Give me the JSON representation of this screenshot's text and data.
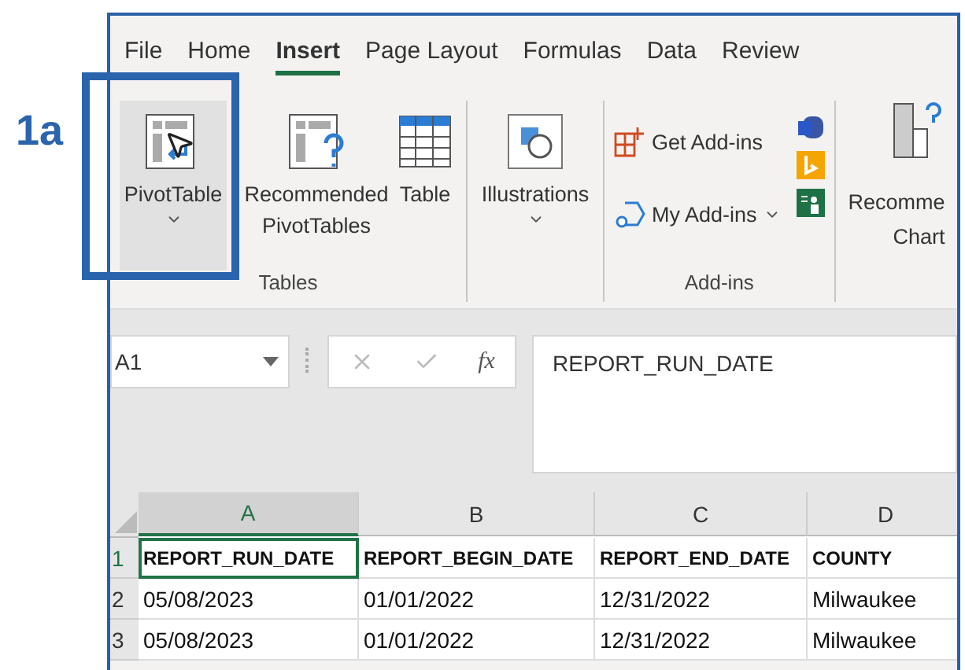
{
  "callout": {
    "label": "1a"
  },
  "tabs": [
    {
      "label": "File",
      "selected": false
    },
    {
      "label": "Home",
      "selected": false
    },
    {
      "label": "Insert",
      "selected": true
    },
    {
      "label": "Page Layout",
      "selected": false
    },
    {
      "label": "Formulas",
      "selected": false
    },
    {
      "label": "Data",
      "selected": false
    },
    {
      "label": "Review",
      "selected": false
    }
  ],
  "ribbon": {
    "groups": [
      {
        "label": "Tables",
        "items": [
          {
            "kind": "pivot",
            "label": "PivotTable",
            "hovered": true,
            "dropdown": true
          },
          {
            "kind": "recommended",
            "label": "Recommended PivotTables",
            "hovered": false,
            "dropdown": false
          },
          {
            "kind": "table",
            "label": "Table",
            "hovered": false,
            "dropdown": false
          }
        ]
      },
      {
        "items": [
          {
            "kind": "illustrations",
            "label": "Illustrations",
            "hovered": false,
            "dropdown": true
          }
        ]
      },
      {
        "label": "Add-ins",
        "items": [
          {
            "kind": "get-addins",
            "label": "Get Add-ins",
            "hovered": false,
            "dropdown": false
          },
          {
            "kind": "my-addins",
            "label": "My Add-ins",
            "hovered": false,
            "dropdown": true
          }
        ]
      }
    ],
    "charts": {
      "line_1": "Recomme",
      "line_2": "Chart"
    }
  },
  "formula_bar": {
    "name_box": "A1",
    "function_label": "fx",
    "formula": "REPORT_RUN_DATE"
  },
  "sheet": {
    "columns": [
      {
        "label": "A",
        "selected": true
      },
      {
        "label": "B",
        "selected": false
      },
      {
        "label": "C",
        "selected": false
      },
      {
        "label": "D",
        "selected": false
      }
    ],
    "rows": [
      {
        "number": "1",
        "selected": true,
        "bold": true,
        "cells": [
          "REPORT_RUN_DATE",
          "REPORT_BEGIN_DATE",
          "REPORT_END_DATE",
          "COUNTY"
        ]
      },
      {
        "number": "2",
        "selected": false,
        "bold": false,
        "cells": [
          "05/08/2023",
          "01/01/2022",
          "12/31/2022",
          "Milwaukee"
        ]
      },
      {
        "number": "3",
        "selected": false,
        "bold": false,
        "cells": [
          "05/08/2023",
          "01/01/2022",
          "12/31/2022",
          "Milwaukee"
        ]
      }
    ]
  }
}
